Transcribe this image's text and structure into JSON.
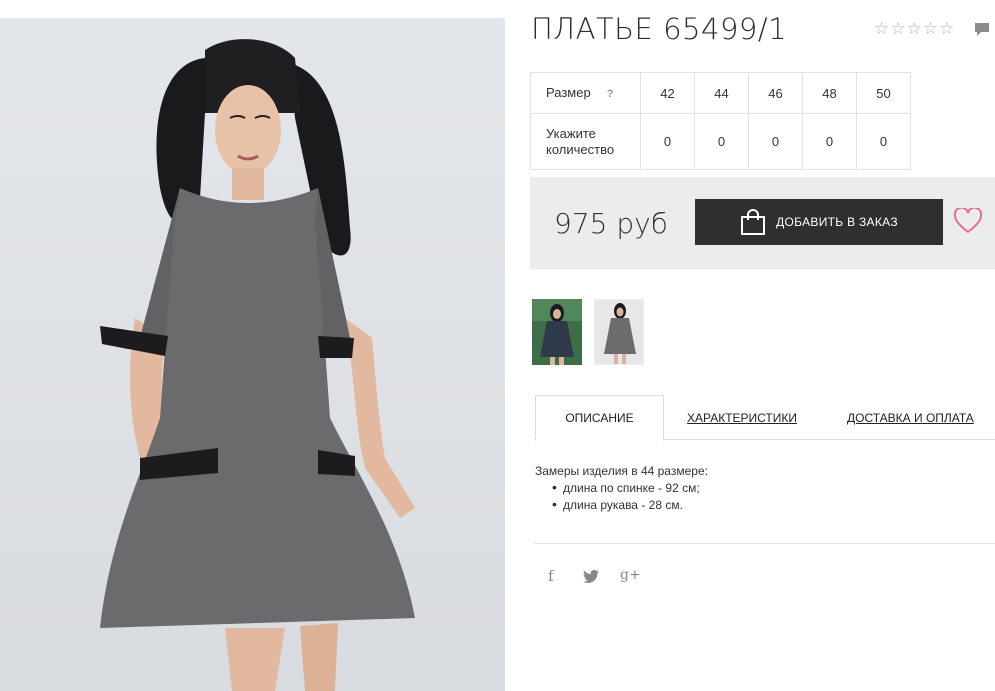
{
  "product": {
    "title": "ПЛАТЬЕ 65499/1",
    "rating": {
      "max": 5,
      "value": 0
    },
    "price": "975 руб"
  },
  "size_table": {
    "size_label": "Размер",
    "help": "?",
    "qty_label": "Укажите количество",
    "sizes": [
      "42",
      "44",
      "46",
      "48",
      "50"
    ],
    "quantities": [
      "0",
      "0",
      "0",
      "0",
      "0"
    ]
  },
  "actions": {
    "add_to_order": "ДОБАВИТЬ В ЗАКАЗ"
  },
  "tabs": [
    {
      "label": "ОПИСАНИЕ"
    },
    {
      "label": "ХАРАКТЕРИСТИКИ"
    },
    {
      "label": "ДОСТАВКА И ОПЛАТА"
    }
  ],
  "description": {
    "intro": "Замеры изделия в 44 размере:",
    "items": [
      "длина по спинке - 92 см;",
      "длина рукава - 28 см."
    ]
  },
  "social": {
    "facebook": "f",
    "twitter": "t",
    "google": "g+"
  },
  "colors": {
    "button": "#2f2f2f",
    "heart": "#e46f86",
    "price_box": "#ececec",
    "dress": "#6b6b6d"
  }
}
